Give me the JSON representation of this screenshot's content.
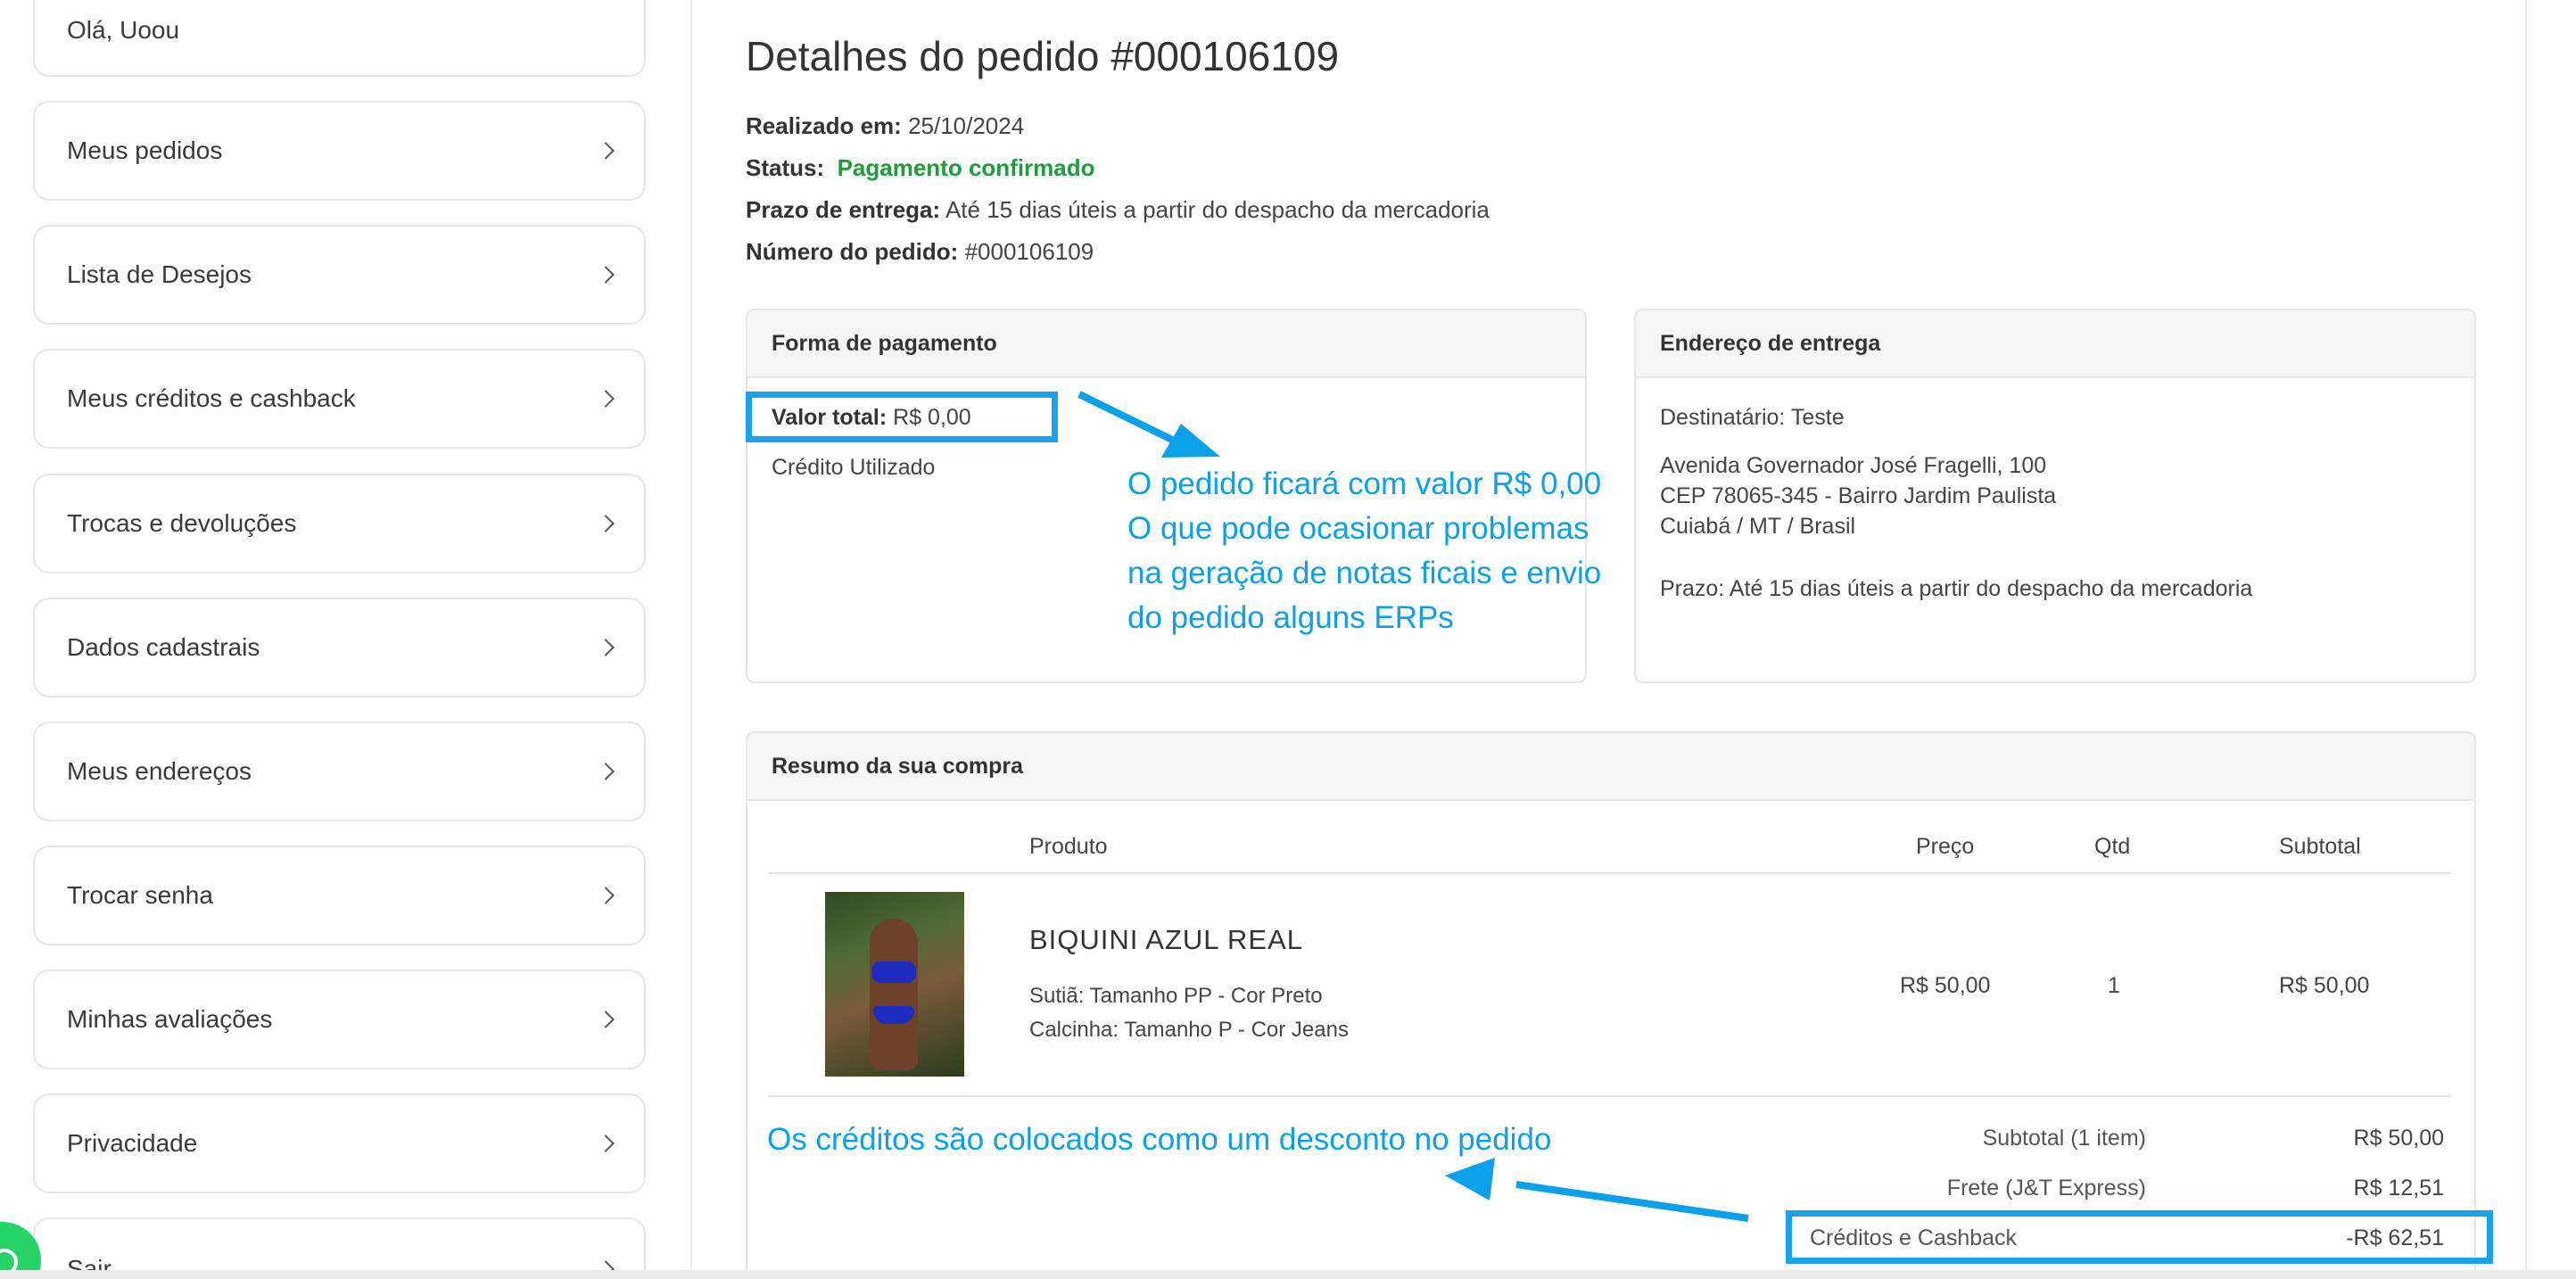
{
  "sidebar": {
    "greeting": "Olá, Uoou",
    "items": [
      {
        "label": "Meus pedidos"
      },
      {
        "label": "Lista de Desejos"
      },
      {
        "label": "Meus créditos e cashback"
      },
      {
        "label": "Trocas e devoluções"
      },
      {
        "label": "Dados cadastrais"
      },
      {
        "label": "Meus endereços"
      },
      {
        "label": "Trocar senha"
      },
      {
        "label": "Minhas avaliações"
      },
      {
        "label": "Privacidade"
      },
      {
        "label": "Sair"
      }
    ]
  },
  "order": {
    "title": "Detalhes do pedido #000106109",
    "placed_label": "Realizado em:",
    "placed_value": "25/10/2024",
    "status_label": "Status:",
    "status_value": "Pagamento confirmado",
    "deadline_label": "Prazo de entrega:",
    "deadline_value": "Até 15 dias úteis a partir do despacho da mercadoria",
    "number_label": "Número do pedido:",
    "number_value": "#000106109"
  },
  "payment": {
    "heading": "Forma de pagamento",
    "total_label": "Valor total:",
    "total_value": "R$ 0,00",
    "credit_used": "Crédito Utilizado"
  },
  "shipping": {
    "heading": "Endereço de entrega",
    "recipient": "Destinatário: Teste",
    "address_line1": "Avenida Governador José Fragelli, 100",
    "address_line2": "CEP 78065-345 - Bairro Jardim Paulista",
    "address_line3": "Cuiabá / MT / Brasil",
    "deadline": "Prazo: Até 15 dias úteis a partir do despacho da mercadoria"
  },
  "summary": {
    "heading": "Resumo da sua compra",
    "columns": {
      "product": "Produto",
      "price": "Preço",
      "qty": "Qtd",
      "subtotal": "Subtotal"
    },
    "item": {
      "name": "BIQUINI AZUL REAL",
      "variant1": "Sutiã: Tamanho PP - Cor Preto",
      "variant2": "Calcinha: Tamanho P - Cor Jeans",
      "price": "R$ 50,00",
      "qty": "1",
      "subtotal": "R$ 50,00"
    },
    "totals": [
      {
        "label": "Subtotal (1 item)",
        "value": "R$ 50,00"
      },
      {
        "label": "Frete (J&T Express)",
        "value": "R$ 12,51"
      },
      {
        "label": "Créditos e Cashback",
        "value": "-R$ 62,51"
      }
    ]
  },
  "annotations": {
    "top_line1": "O pedido ficará com valor R$ 0,00",
    "top_line2": "O que pode ocasionar problemas",
    "top_line3": "na geração de notas ficais e envio",
    "top_line4": "do pedido alguns ERPs",
    "bottom": "Os créditos são colocados como um desconto no pedido",
    "color": "#0aa0ea"
  },
  "colors": {
    "status_green": "#1e9e3a",
    "highlight_blue": "#1aa3ea"
  }
}
